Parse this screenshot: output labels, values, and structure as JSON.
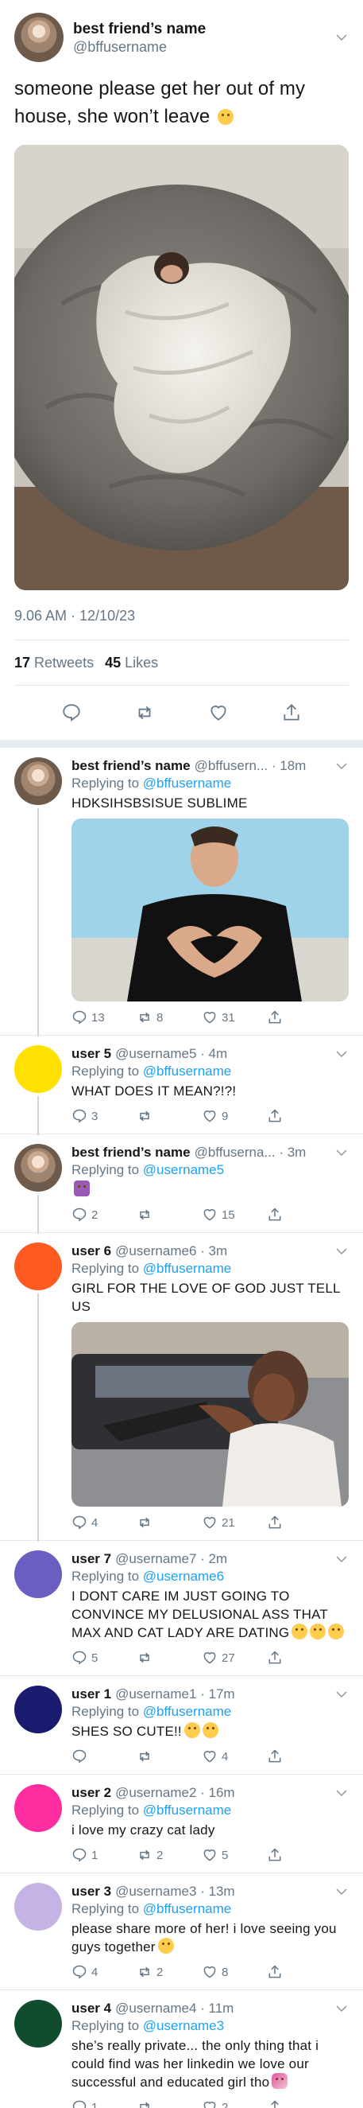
{
  "tweet": {
    "author_name": "best friend’s name",
    "author_handle": "@bffusername",
    "text": "someone please get her out of my house, she won’t leave",
    "text_emoji": "sad-face-emoji",
    "timestamp": "9.06 AM · 12/10/23",
    "retweets_count": "17",
    "retweets_label": "Retweets",
    "likes_count": "45",
    "likes_label": "Likes"
  },
  "replies": [
    {
      "name": "best friend’s name",
      "handle": "@bffusern... · 18m",
      "replying_prefix": "Replying to ",
      "replying_to": "@bffusername",
      "text": "HDKSIHSBSISUE SUBLIME",
      "reply_count": "13",
      "retweet_count": "8",
      "like_count": "31",
      "avatar_color": "#8a7060"
    },
    {
      "name": "user 5",
      "handle": "@username5 · 4m",
      "replying_prefix": "Replying to ",
      "replying_to": "@bffusername",
      "text": "WHAT DOES IT MEAN?!?!",
      "reply_count": "3",
      "retweet_count": "",
      "like_count": "9",
      "avatar_color": "#ffe000"
    },
    {
      "name": "best friend’s name",
      "handle": "@bffuserna... · 3m",
      "replying_prefix": "Replying to ",
      "replying_to": "@username5",
      "text": "",
      "reply_count": "2",
      "retweet_count": "",
      "like_count": "15",
      "avatar_color": "#8a7060"
    },
    {
      "name": "user 6",
      "handle": "@username6 · 3m",
      "replying_prefix": "Replying to ",
      "replying_to": "@bffusername",
      "text": "GIRL FOR THE LOVE OF GOD JUST TELL US",
      "reply_count": "4",
      "retweet_count": "",
      "like_count": "21",
      "avatar_color": "#ff5a1f"
    },
    {
      "name": "user 7",
      "handle": "@username7 · 2m",
      "replying_prefix": "Replying to ",
      "replying_to": "@username6",
      "text": "I DONT CARE IM JUST GOING TO CONVINCE MY DELUSIONAL ASS THAT MAX AND CAT LADY ARE DATING",
      "reply_count": "5",
      "retweet_count": "",
      "like_count": "27",
      "avatar_color": "#6a5fc1"
    },
    {
      "name": "user 1",
      "handle": "@username1 · 17m",
      "replying_prefix": "Replying to ",
      "replying_to": "@bffusername",
      "text": "SHES SO CUTE!!",
      "reply_count": "",
      "retweet_count": "",
      "like_count": "4",
      "avatar_color": "#1a1a6e"
    },
    {
      "name": "user 2",
      "handle": "@username2 · 16m",
      "replying_prefix": "Replying to ",
      "replying_to": "@bffusername",
      "text": "i love my crazy cat lady",
      "reply_count": "1",
      "retweet_count": "2",
      "like_count": "5",
      "avatar_color": "#ff2ea0"
    },
    {
      "name": "user 3",
      "handle": "@username3 · 13m",
      "replying_prefix": "Replying to ",
      "replying_to": "@bffusername",
      "text": "please share more of her! i love seeing you guys together",
      "reply_count": "4",
      "retweet_count": "2",
      "like_count": "8",
      "avatar_color": "#c6b3e6"
    },
    {
      "name": "user 4",
      "handle": "@username4 · 11m",
      "replying_prefix": "Replying to ",
      "replying_to": "@username3",
      "text": "she’s really private... the only thing that i could find was her linkedin we love our successful and educated girl tho",
      "reply_count": "1",
      "retweet_count": "",
      "like_count": "2",
      "avatar_color": "#0f4d2e"
    }
  ],
  "colors": {
    "link": "#1da1f2",
    "secondary_text": "#657786",
    "divider": "#e1e8ed"
  }
}
